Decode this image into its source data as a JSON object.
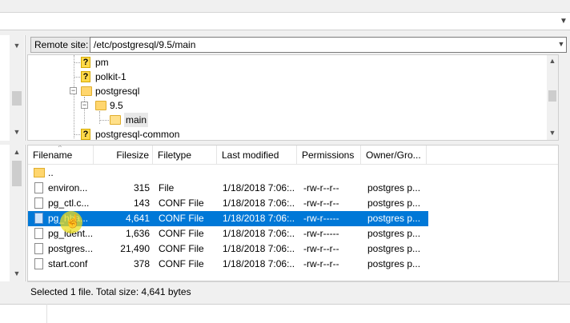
{
  "remote": {
    "label": "Remote site:",
    "path": "/etc/postgresql/9.5/main"
  },
  "tree": {
    "items": [
      {
        "label": "pm",
        "icon": "question-folder-icon"
      },
      {
        "label": "polkit-1",
        "icon": "question-folder-icon"
      },
      {
        "label": "postgresql",
        "icon": "folder-icon",
        "toggle": "−"
      },
      {
        "label": "9.5",
        "icon": "folder-icon",
        "toggle": "−"
      },
      {
        "label": "main",
        "icon": "folder-open-icon",
        "selected": true
      },
      {
        "label": "postgresql-common",
        "icon": "question-folder-icon"
      }
    ]
  },
  "list": {
    "columns": [
      "Filename",
      "Filesize",
      "Filetype",
      "Last modified",
      "Permissions",
      "Owner/Gro..."
    ],
    "rows": [
      {
        "name": "..",
        "size": "",
        "type": "",
        "modified": "",
        "perms": "",
        "owner": "",
        "icon": "folder-icon"
      },
      {
        "name": "environ...",
        "size": "315",
        "type": "File",
        "modified": "1/18/2018 7:06:...",
        "perms": "-rw-r--r--",
        "owner": "postgres p...",
        "icon": "file-icon"
      },
      {
        "name": "pg_ctl.c...",
        "size": "143",
        "type": "CONF File",
        "modified": "1/18/2018 7:06:...",
        "perms": "-rw-r--r--",
        "owner": "postgres p...",
        "icon": "file-icon"
      },
      {
        "name": "pg_hba...",
        "size": "4,641",
        "type": "CONF File",
        "modified": "1/18/2018 7:06:...",
        "perms": "-rw-r-----",
        "owner": "postgres p...",
        "icon": "file-icon",
        "selected": true
      },
      {
        "name": "pg_ident...",
        "size": "1,636",
        "type": "CONF File",
        "modified": "1/18/2018 7:06:...",
        "perms": "-rw-r-----",
        "owner": "postgres p...",
        "icon": "file-icon"
      },
      {
        "name": "postgres...",
        "size": "21,490",
        "type": "CONF File",
        "modified": "1/18/2018 7:06:...",
        "perms": "-rw-r--r--",
        "owner": "postgres p...",
        "icon": "file-icon"
      },
      {
        "name": "start.conf",
        "size": "378",
        "type": "CONF File",
        "modified": "1/18/2018 7:06:...",
        "perms": "-rw-r--r--",
        "owner": "postgres p...",
        "icon": "file-icon"
      }
    ]
  },
  "status": {
    "text": "Selected 1 file. Total size: 4,641 bytes"
  },
  "colors": {
    "selection": "#0078d7",
    "cursor_highlight": "#ebdc1e",
    "folder": "#ffd66e"
  }
}
